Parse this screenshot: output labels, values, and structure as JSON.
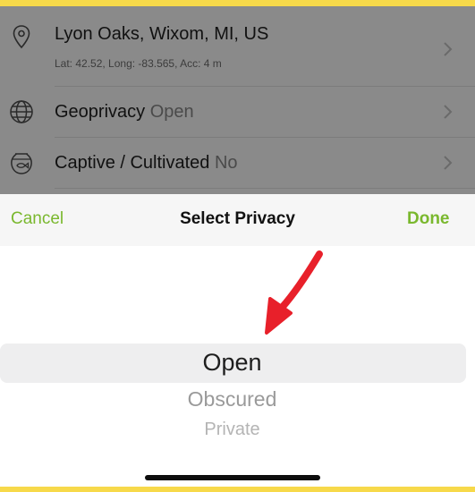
{
  "location": {
    "name": "Lyon Oaks, Wixom, MI, US",
    "details": "Lat: 42.52, Long: -83.565, Acc: 4 m",
    "icon": "map-pin-icon"
  },
  "geoprivacy": {
    "label": "Geoprivacy",
    "value": "Open",
    "icon": "globe-icon"
  },
  "captive": {
    "label": "Captive / Cultivated",
    "value": "No",
    "icon": "fishbowl-icon"
  },
  "toolbar": {
    "cancel_label": "Cancel",
    "title": "Select Privacy",
    "done_label": "Done"
  },
  "picker": {
    "options": [
      "Open",
      "Obscured",
      "Private"
    ],
    "selected": "Open"
  },
  "colors": {
    "accent": "#7ab82e",
    "annotation_arrow": "#e8202a",
    "frame": "#f7d94a"
  }
}
